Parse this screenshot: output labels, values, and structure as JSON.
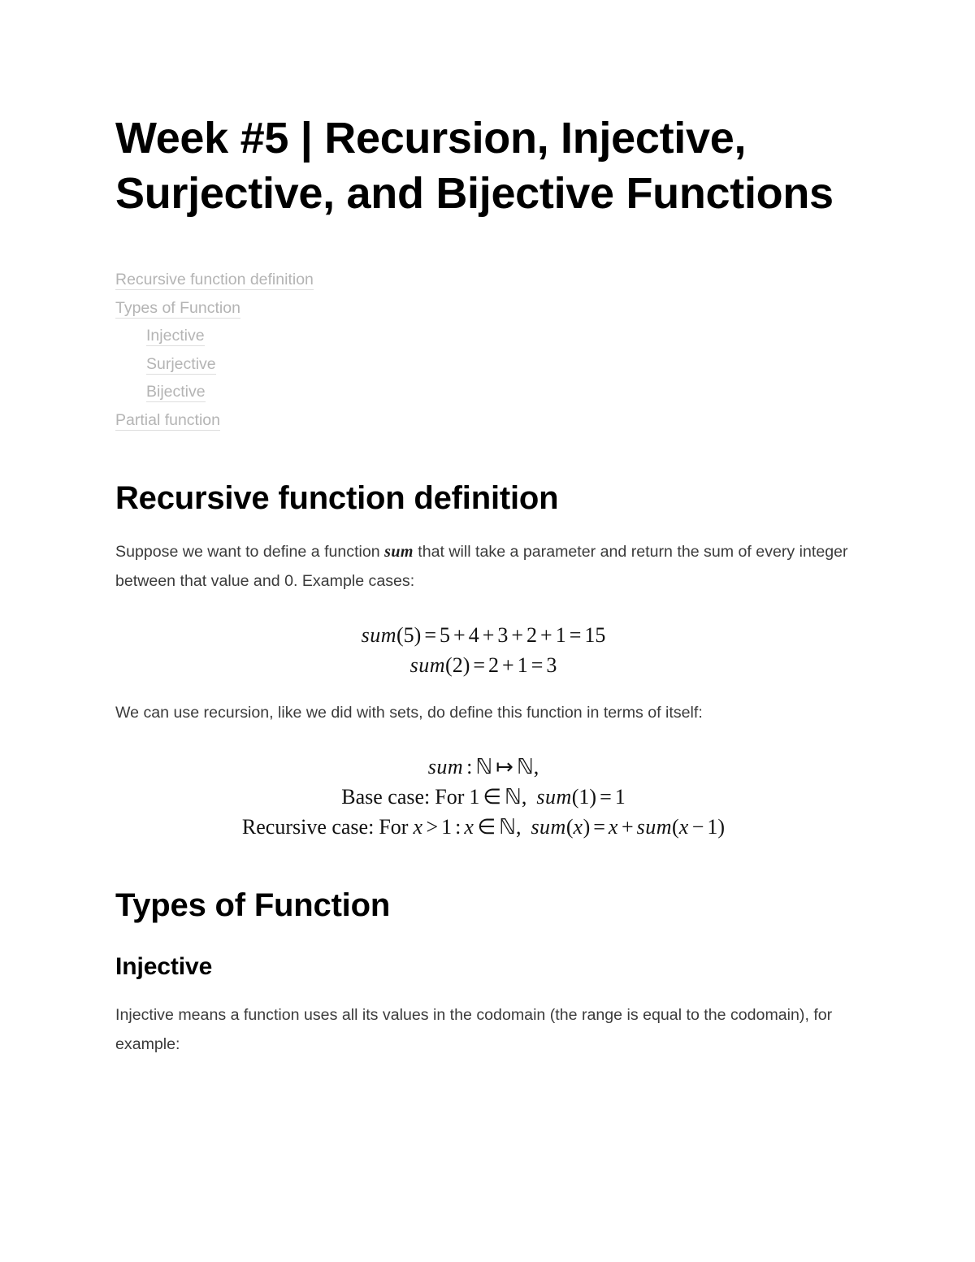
{
  "document": {
    "title": "Week #5 | Recursion, Injective, Surjective, and Bijective Functions"
  },
  "toc": {
    "items": [
      {
        "label": "Recursive function definition",
        "indent": false
      },
      {
        "label": "Types of Function",
        "indent": false
      },
      {
        "label": "Injective",
        "indent": true
      },
      {
        "label": "Surjective",
        "indent": true
      },
      {
        "label": "Bijective",
        "indent": true
      },
      {
        "label": "Partial function",
        "indent": false
      }
    ]
  },
  "sections": {
    "recursive": {
      "heading": "Recursive function definition",
      "paragraph_1_before": "Suppose we want to define a function ",
      "paragraph_1_math": "sum",
      "paragraph_1_after": " that will take a parameter and return the sum of every integer between that value and 0. Example cases:",
      "example_math": {
        "line_1": "sum(5) = 5 + 4 + 3 + 2 + 1 = 15",
        "line_2": "sum(2) = 2 + 1 = 3"
      },
      "paragraph_2": "We can use recursion, like we did with sets, do define this function in terms of itself:",
      "definition_math": {
        "line_1": "sum : ℕ ↦ ℕ,",
        "line_2": "Base case: For 1 ∈ ℕ, sum(1) = 1",
        "line_3": "Recursive case: For x > 1 : x ∈ ℕ, sum(x) = x + sum(x − 1)"
      }
    },
    "types": {
      "heading": "Types of Function",
      "injective": {
        "heading": "Injective",
        "paragraph": "Injective means a function uses all its values in the codomain (the range is equal to the codomain), for example:"
      }
    }
  },
  "colors": {
    "page_background": "#ffffff",
    "heading_text": "#000000",
    "body_text": "#3b3b3b",
    "toc_link": "#b4b4b4",
    "toc_underline": "#dedede",
    "math_text": "#111111"
  }
}
